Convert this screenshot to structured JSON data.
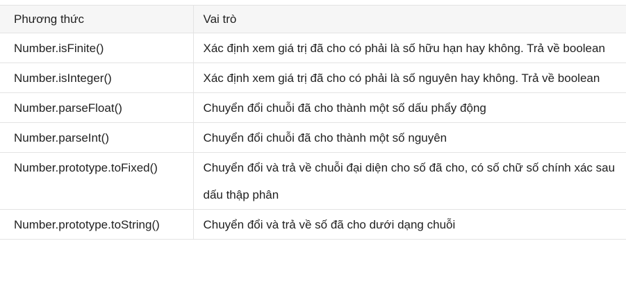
{
  "table": {
    "headers": [
      "Phương thức",
      "Vai trò"
    ],
    "rows": [
      {
        "method": "Number.isFinite()",
        "role": "Xác định xem giá trị đã cho có phải là số hữu hạn hay không. Trả về boolean"
      },
      {
        "method": "Number.isInteger()",
        "role": "Xác định xem giá trị đã cho có phải là số nguyên hay không. Trả về boolean"
      },
      {
        "method": "Number.parseFloat()",
        "role": "Chuyển đổi chuỗi đã cho thành một số dấu phẩy động"
      },
      {
        "method": "Number.parseInt()",
        "role": "Chuyển đổi chuỗi đã cho thành một số nguyên"
      },
      {
        "method": "Number.prototype.toFixed()",
        "role": "Chuyển đổi và trả về chuỗi đại diện cho số đã cho, có số chữ số chính xác sau dấu thập phân"
      },
      {
        "method": "Number.prototype.toString()",
        "role": "Chuyển đổi và trả về số đã cho dưới dạng chuỗi"
      }
    ]
  }
}
